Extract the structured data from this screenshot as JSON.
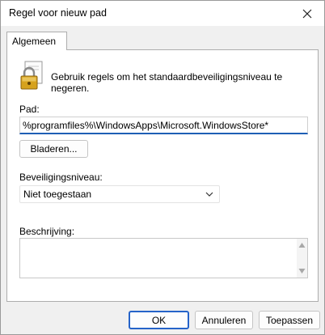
{
  "window": {
    "title": "Regel voor nieuw pad"
  },
  "tabs": [
    {
      "label": "Algemeen"
    }
  ],
  "general": {
    "description": "Gebruik regels om het standaardbeveiligingsniveau te negeren.",
    "path_label": "Pad:",
    "path_value": "%programfiles%\\WindowsApps\\Microsoft.WindowsStore*",
    "browse_label": "Bladeren...",
    "security_level_label": "Beveiligingsniveau:",
    "security_level_value": "Niet toegestaan",
    "description_field_label": "Beschrijving:",
    "description_field_value": ""
  },
  "buttons": {
    "ok": "OK",
    "cancel": "Annuleren",
    "apply": "Toepassen"
  },
  "icons": {
    "close": "close-icon",
    "lock": "lock-document-icon",
    "dropdown": "chevron-down-icon",
    "scroll_up": "scroll-up-icon",
    "scroll_down": "scroll-down-icon"
  },
  "colors": {
    "accent": "#1f5fb5",
    "default_button_border": "#2563c9"
  }
}
